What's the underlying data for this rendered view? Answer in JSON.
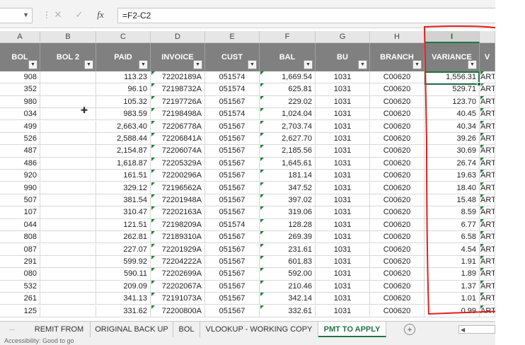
{
  "formula_bar": {
    "name_box": "",
    "cancel_icon": "✕",
    "enter_icon": "✓",
    "fx_label": "fx",
    "formula": "=F2-C2"
  },
  "columns": [
    {
      "letter": "A",
      "header": "BOL"
    },
    {
      "letter": "B",
      "header": "BOL 2"
    },
    {
      "letter": "C",
      "header": "PAID"
    },
    {
      "letter": "D",
      "header": "INVOICE"
    },
    {
      "letter": "E",
      "header": "CUST"
    },
    {
      "letter": "F",
      "header": "BAL"
    },
    {
      "letter": "G",
      "header": "BU"
    },
    {
      "letter": "H",
      "header": "BRANCH"
    },
    {
      "letter": "I",
      "header": "VARIANCE"
    },
    {
      "letter": "",
      "header": "V"
    }
  ],
  "rows": [
    [
      "908",
      "",
      "113.23",
      "72202189A",
      "051574",
      "1,669.54",
      "1031",
      "C00620",
      "1,556.31",
      "ARTM"
    ],
    [
      "352",
      "",
      "96.10",
      "72198732A",
      "051574",
      "625.81",
      "1031",
      "C00620",
      "529.71",
      "ARTM"
    ],
    [
      "980",
      "",
      "105.32",
      "72197726A",
      "051567",
      "229.02",
      "1031",
      "C00620",
      "123.70",
      "ARTM"
    ],
    [
      "034",
      "",
      "983.59",
      "72198498A",
      "051574",
      "1,024.04",
      "1031",
      "C00620",
      "40.45",
      "ARTM"
    ],
    [
      "499",
      "",
      "2,663.40",
      "72206778A",
      "051567",
      "2,703.74",
      "1031",
      "C00620",
      "40.34",
      "ARTM"
    ],
    [
      "526",
      "",
      "2,588.44",
      "72206841A",
      "051567",
      "2,627.70",
      "1031",
      "C00620",
      "39.26",
      "ARTM"
    ],
    [
      "487",
      "",
      "2,154.87",
      "72206074A",
      "051567",
      "2,185.56",
      "1031",
      "C00620",
      "30.69",
      "ARTM"
    ],
    [
      "486",
      "",
      "1,618.87",
      "72205329A",
      "051567",
      "1,645.61",
      "1031",
      "C00620",
      "26.74",
      "ARTM"
    ],
    [
      "920",
      "",
      "161.51",
      "72200296A",
      "051567",
      "181.14",
      "1031",
      "C00620",
      "19.63",
      "ARTM"
    ],
    [
      "990",
      "",
      "329.12",
      "72196562A",
      "051567",
      "347.52",
      "1031",
      "C00620",
      "18.40",
      "ARTM"
    ],
    [
      "507",
      "",
      "381.54",
      "72201948A",
      "051567",
      "397.02",
      "1031",
      "C00620",
      "15.48",
      "ARTM"
    ],
    [
      "107",
      "",
      "310.47",
      "72202163A",
      "051567",
      "319.06",
      "1031",
      "C00620",
      "8.59",
      "ARTM"
    ],
    [
      "044",
      "",
      "121.51",
      "72198209A",
      "051574",
      "128.28",
      "1031",
      "C00620",
      "6.77",
      "ARTM"
    ],
    [
      "808",
      "",
      "262.81",
      "72189310A",
      "051567",
      "269.39",
      "1031",
      "C00620",
      "6.58",
      "ARTM"
    ],
    [
      "087",
      "",
      "227.07",
      "72201929A",
      "051567",
      "231.61",
      "1031",
      "C00620",
      "4.54",
      "ARTM"
    ],
    [
      "291",
      "",
      "599.92",
      "72204222A",
      "051567",
      "601.83",
      "1031",
      "C00620",
      "1.91",
      "ARTM"
    ],
    [
      "080",
      "",
      "590.11",
      "72202699A",
      "051567",
      "592.00",
      "1031",
      "C00620",
      "1.89",
      "ARTM"
    ],
    [
      "532",
      "",
      "209.09",
      "72202067A",
      "051567",
      "210.46",
      "1031",
      "C00620",
      "1.37",
      "ARTM"
    ],
    [
      "261",
      "",
      "341.13",
      "72191073A",
      "051567",
      "342.14",
      "1031",
      "C00620",
      "1.01",
      "ARTM"
    ],
    [
      "125",
      "",
      "331.62",
      "72200800A",
      "051567",
      "332.61",
      "1031",
      "C00620",
      "0.99",
      "ARTM"
    ]
  ],
  "filter_glyph": "▼",
  "sheet_tabs": [
    "REMIT FROM",
    "ORIGINAL BACK UP",
    "BOL",
    "VLOOKUP - WORKING COPY",
    "PMT TO APPLY"
  ],
  "active_tab": "PMT TO APPLY",
  "tab_lead": "...",
  "add_sheet": "+",
  "status_text": "Accessibility: Good to go",
  "colors": {
    "accent": "#217346",
    "header_fill": "#808080",
    "annotation": "#e0201b"
  }
}
